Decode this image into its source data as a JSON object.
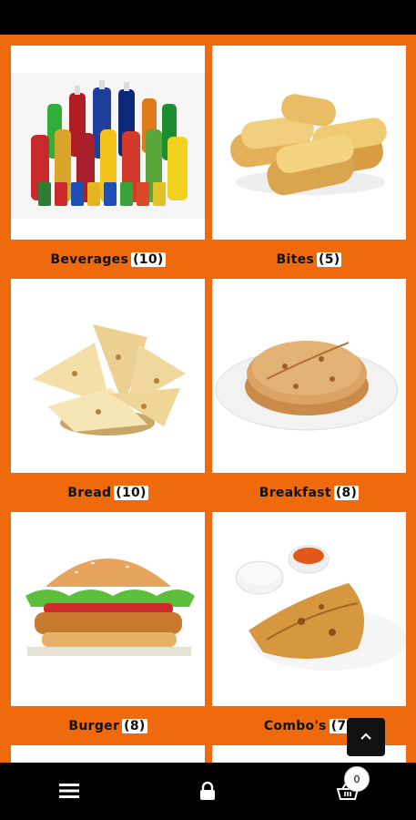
{
  "categories": [
    {
      "name": "Beverages",
      "count": "(10)",
      "icon": "beverages-image"
    },
    {
      "name": "Bites",
      "count": "(5)",
      "icon": "bites-image"
    },
    {
      "name": "Bread",
      "count": "(10)",
      "icon": "bread-image"
    },
    {
      "name": "Breakfast",
      "count": "(8)",
      "icon": "breakfast-image"
    },
    {
      "name": "Burger",
      "count": "(8)",
      "icon": "burger-image"
    },
    {
      "name": "Combo's",
      "count": "(7)",
      "icon": "combos-image"
    }
  ],
  "nav": {
    "menu_icon": "hamburger-menu-icon",
    "account_icon": "lock-icon",
    "cart_icon": "shopping-basket-icon",
    "cart_count": "0"
  },
  "scroll_top_icon": "chevron-up-icon",
  "colors": {
    "background": "#ee6a0c",
    "bars": "#000000"
  }
}
